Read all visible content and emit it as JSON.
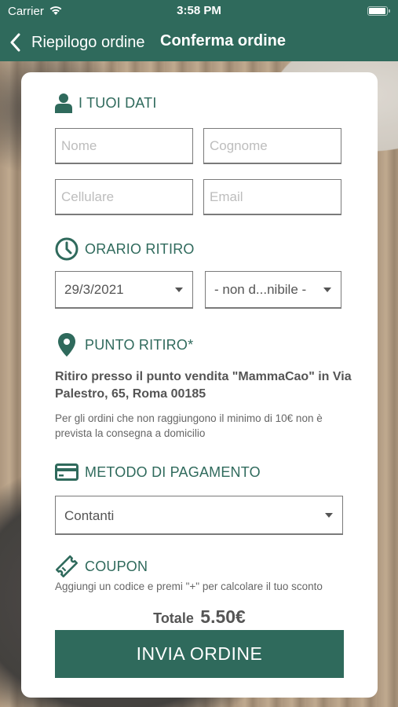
{
  "status_bar": {
    "carrier": "Carrier",
    "time": "3:58 PM"
  },
  "nav": {
    "back_label": "Riepilogo ordine",
    "title": "Conferma ordine"
  },
  "sections": {
    "your_data": {
      "title": "I TUOI DATI",
      "icon": "user-icon"
    },
    "pickup_time": {
      "title": "ORARIO RITIRO",
      "icon": "clock-icon"
    },
    "pickup_point": {
      "title": "PUNTO RITIRO*",
      "icon": "map-pin-icon"
    },
    "payment": {
      "title": "METODO DI PAGAMENTO",
      "icon": "credit-card-icon"
    },
    "coupon": {
      "title": "COUPON",
      "icon": "ticket-icon"
    }
  },
  "form": {
    "first_name": {
      "placeholder": "Nome",
      "value": ""
    },
    "last_name": {
      "placeholder": "Cognome",
      "value": ""
    },
    "phone": {
      "placeholder": "Cellulare",
      "value": ""
    },
    "email": {
      "placeholder": "Email",
      "value": ""
    },
    "pickup_date": "29/3/2021",
    "pickup_slot": "- non d...nibile -",
    "payment_method": "Contanti"
  },
  "pickup": {
    "address": "Ritiro presso il punto vendita \"MammaCao\" in Via Palestro, 65, Roma 00185",
    "note": "Per gli ordini che non raggiungono il minimo di 10€ non è prevista la consegna a domicilio"
  },
  "coupon_hint": "Aggiungi un codice e premi \"+\" per calcolare il tuo sconto",
  "total": {
    "label": "Totale",
    "value": "5.50€"
  },
  "submit_label": "INVIA ORDINE",
  "colors": {
    "brand": "#2f6a5c",
    "text": "#555555",
    "placeholder": "#bdbdbd"
  }
}
